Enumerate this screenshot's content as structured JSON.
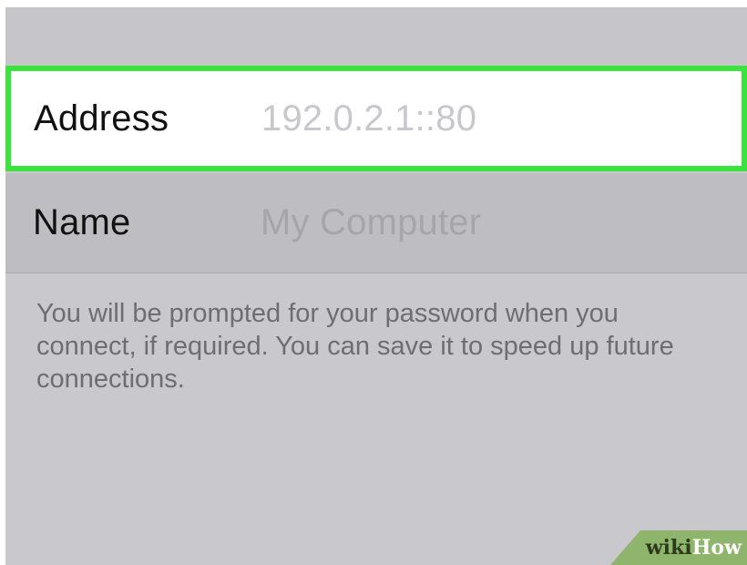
{
  "form": {
    "address": {
      "label": "Address",
      "placeholder": "192.0.2.1::80"
    },
    "name": {
      "label": "Name",
      "placeholder": "My Computer"
    }
  },
  "footer_note": "You will be prompted for your password when you connect, if required. You can save it to speed up future connections.",
  "watermark": {
    "part1": "wiki",
    "part2": "How"
  },
  "colors": {
    "highlight": "#39e53a",
    "background": "#c9c8cd",
    "watermark_bg": "#8fb46b"
  }
}
